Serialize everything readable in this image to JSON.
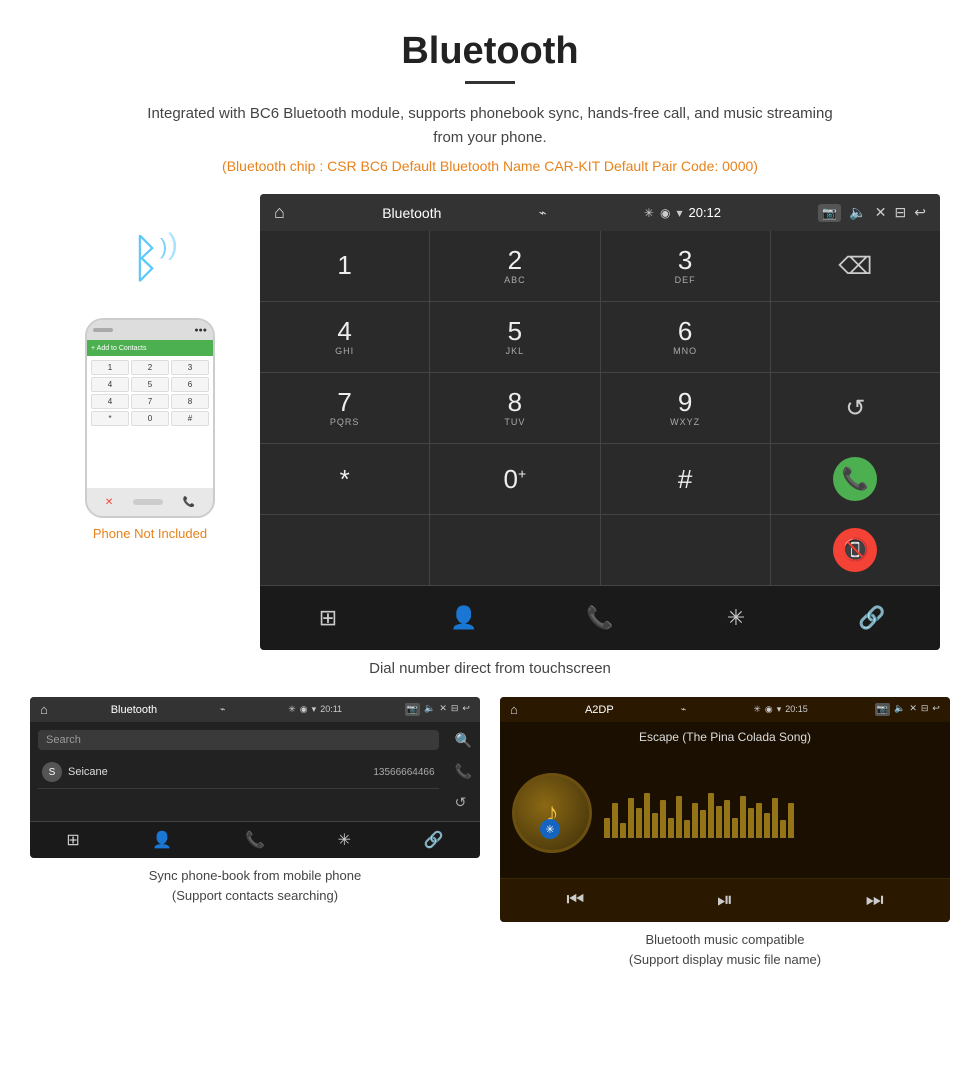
{
  "page": {
    "title": "Bluetooth",
    "title_underline": true,
    "description": "Integrated with BC6 Bluetooth module, supports phonebook sync, hands-free call, and music streaming from your phone.",
    "specs": "(Bluetooth chip : CSR BC6    Default Bluetooth Name CAR-KIT    Default Pair Code: 0000)",
    "main_caption": "Dial number direct from touchscreen",
    "phone_label": "Phone Not Included"
  },
  "car_screen": {
    "title": "Bluetooth",
    "time": "20:12",
    "status_icons": [
      "bluetooth",
      "location",
      "wifi",
      "signal"
    ],
    "dialpad": [
      {
        "num": "1",
        "letters": ""
      },
      {
        "num": "2",
        "letters": "ABC"
      },
      {
        "num": "3",
        "letters": "DEF"
      },
      {
        "num": "",
        "letters": "",
        "type": "empty"
      },
      {
        "num": "4",
        "letters": "GHI"
      },
      {
        "num": "5",
        "letters": "JKL"
      },
      {
        "num": "6",
        "letters": "MNO"
      },
      {
        "num": "",
        "letters": "",
        "type": "empty"
      },
      {
        "num": "7",
        "letters": "PQRS"
      },
      {
        "num": "8",
        "letters": "TUV"
      },
      {
        "num": "9",
        "letters": "WXYZ"
      },
      {
        "num": "",
        "letters": "",
        "type": "redial"
      },
      {
        "num": "*",
        "letters": ""
      },
      {
        "num": "0",
        "letters": "+"
      },
      {
        "num": "#",
        "letters": ""
      },
      {
        "num": "",
        "letters": "",
        "type": "call_green"
      }
    ],
    "bottom_nav": [
      "grid",
      "person",
      "phone",
      "bluetooth",
      "link"
    ]
  },
  "phonebook_screen": {
    "title": "Bluetooth",
    "time": "20:11",
    "search_placeholder": "Search",
    "contacts": [
      {
        "letter": "S",
        "name": "Seicane",
        "number": "13566664466"
      }
    ],
    "bottom_nav": [
      "grid",
      "person-active",
      "phone",
      "bluetooth",
      "link"
    ],
    "caption_line1": "Sync phone-book from mobile phone",
    "caption_line2": "(Support contacts searching)"
  },
  "music_screen": {
    "title": "A2DP",
    "time": "20:15",
    "song_title": "Escape (The Pina Colada Song)",
    "viz_heights": [
      20,
      35,
      15,
      40,
      30,
      45,
      25,
      38,
      20,
      42,
      18,
      35,
      28,
      45,
      32,
      38,
      20,
      42,
      30,
      35,
      25,
      40,
      18,
      35
    ],
    "controls": [
      "prev",
      "play-pause",
      "next"
    ],
    "caption_line1": "Bluetooth music compatible",
    "caption_line2": "(Support display music file name)"
  },
  "icons": {
    "home": "⌂",
    "usb": "⌁",
    "bluetooth_small": "✳",
    "location": "◉",
    "wifi": "▾",
    "signal": "▾",
    "camera": "⬜",
    "volume": "◁",
    "close_x": "✕",
    "window": "⬜",
    "back": "↩",
    "backspace": "⌫",
    "redial": "↺",
    "call_green": "📞",
    "call_red": "📵",
    "grid_icon": "⊞",
    "person_icon": "👤",
    "phone_icon": "📞",
    "bt_icon": "✳",
    "link_icon": "🔗",
    "search_icon": "🔍",
    "prev_icon": "⏮",
    "playpause_icon": "⏯",
    "next_icon": "⏭"
  }
}
